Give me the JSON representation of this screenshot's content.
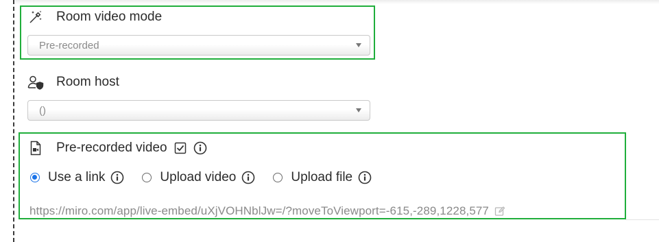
{
  "room_video_mode": {
    "label": "Room video mode",
    "icon": "magic-wand-icon",
    "select_value": "Pre-recorded"
  },
  "room_host": {
    "label": "Room host",
    "icon": "user-shield-icon",
    "select_value": "()"
  },
  "pre_recorded_video": {
    "label": "Pre-recorded video",
    "icon": "video-file-icon",
    "checkbox_checked": true,
    "options": [
      {
        "label": "Use a link",
        "checked": true
      },
      {
        "label": "Upload video",
        "checked": false
      },
      {
        "label": "Upload file",
        "checked": false
      }
    ],
    "link_url": "https://miro.com/app/live-embed/uXjVOHNblJw=/?moveToViewport=-615,-289,1228,577"
  },
  "colors": {
    "highlight": "#1fae3b",
    "radio_accent": "#1a73e8"
  }
}
